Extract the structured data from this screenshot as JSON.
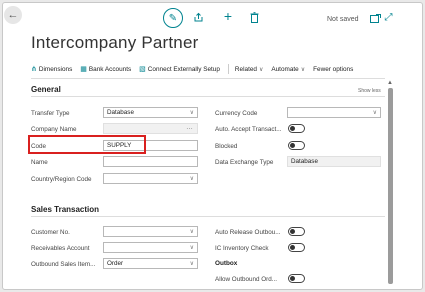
{
  "header": {
    "status": "Not saved",
    "title": "Intercompany Partner"
  },
  "actions": {
    "dimensions": "Dimensions",
    "bank_accounts": "Bank Accounts",
    "connect": "Connect Externally Setup",
    "related": "Related",
    "automate": "Automate",
    "fewer": "Fewer options"
  },
  "general": {
    "heading": "General",
    "show_less": "Show less",
    "transfer_type_label": "Transfer Type",
    "transfer_type_value": "Database",
    "company_name_label": "Company Name",
    "company_name_value": "",
    "code_label": "Code",
    "code_value": "SUPPLY",
    "name_label": "Name",
    "name_value": "",
    "country_label": "Country/Region Code",
    "country_value": "",
    "currency_label": "Currency Code",
    "currency_value": "",
    "auto_accept_label": "Auto. Accept Transact...",
    "auto_accept_on": false,
    "blocked_label": "Blocked",
    "blocked_on": false,
    "data_exchange_label": "Data Exchange Type",
    "data_exchange_value": "Database"
  },
  "sales": {
    "heading": "Sales Transaction",
    "customer_label": "Customer No.",
    "customer_value": "",
    "receivables_label": "Receivables Account",
    "receivables_value": "",
    "outbound_label": "Outbound Sales Item...",
    "outbound_value": "Order",
    "auto_release_label": "Auto Release Outbou...",
    "auto_release_on": false,
    "ic_inventory_label": "IC Inventory Check",
    "ic_inventory_on": false,
    "outbox_label": "Outbox",
    "allow_outbound_label": "Allow Outbound Ord...",
    "allow_outbound_on": false
  },
  "colors": {
    "accent": "#00838f",
    "highlight": "#d9201f"
  }
}
